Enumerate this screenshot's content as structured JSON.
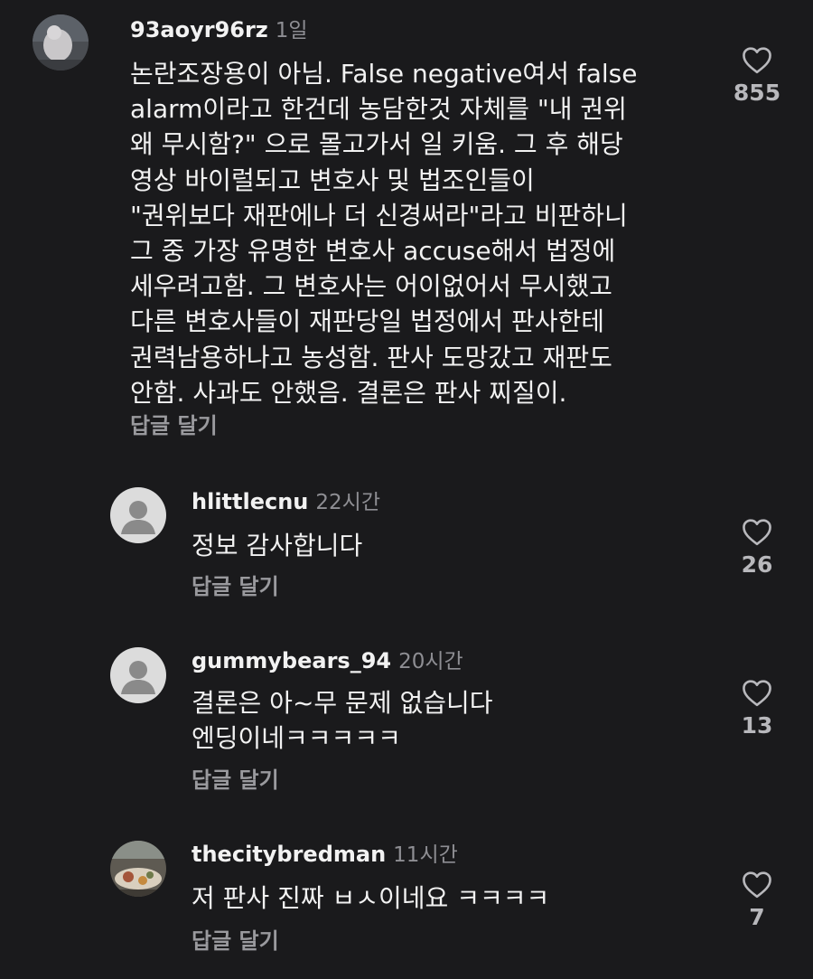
{
  "comments": [
    {
      "username": "93aoyr96rz",
      "time": "1일",
      "text": "논란조장용이 아님. False negative여서 false\nalarm이라고 한건데 농담한것 자체를 \"내 권위\n왜 무시함?\" 으로 몰고가서 일 키움. 그 후 해당\n영상 바이럴되고 변호사 및 법조인들이\n\"권위보다 재판에나 더 신경써라\"라고 비판하니\n그 중 가장 유명한 변호사 accuse해서 법정에\n세우려고함. 그 변호사는 어이없어서 무시했고\n다른 변호사들이 재판당일 법정에서 판사한테\n권력남용하나고 농성함. 판사 도망갔고 재판도\n안함. 사과도 안했음. 결론은 판사 찌질이.",
      "reply_label": "답글 달기",
      "likes": "855",
      "avatar": "photo-avatar"
    },
    {
      "username": "hlittlecnu",
      "time": "22시간",
      "text": "정보 감사합니다",
      "reply_label": "답글 달기",
      "likes": "26",
      "avatar": "default-avatar"
    },
    {
      "username": "gummybears_94",
      "time": "20시간",
      "text": "결론은 아~무 문제 없습니다\n엔딩이네ㅋㅋㅋㅋㅋ",
      "reply_label": "답글 달기",
      "likes": "13",
      "avatar": "default-avatar"
    },
    {
      "username": "thecitybredman",
      "time": "11시간",
      "text": "저 판사 진짜 ㅂㅅ이네요 ㅋㅋㅋㅋ",
      "reply_label": "답글 달기",
      "likes": "7",
      "avatar": "photo-avatar"
    }
  ],
  "colors": {
    "background": "#1a1a1c",
    "text": "#f2f2f2",
    "secondary": "#8e8e93",
    "icon": "#b8b8bc"
  }
}
